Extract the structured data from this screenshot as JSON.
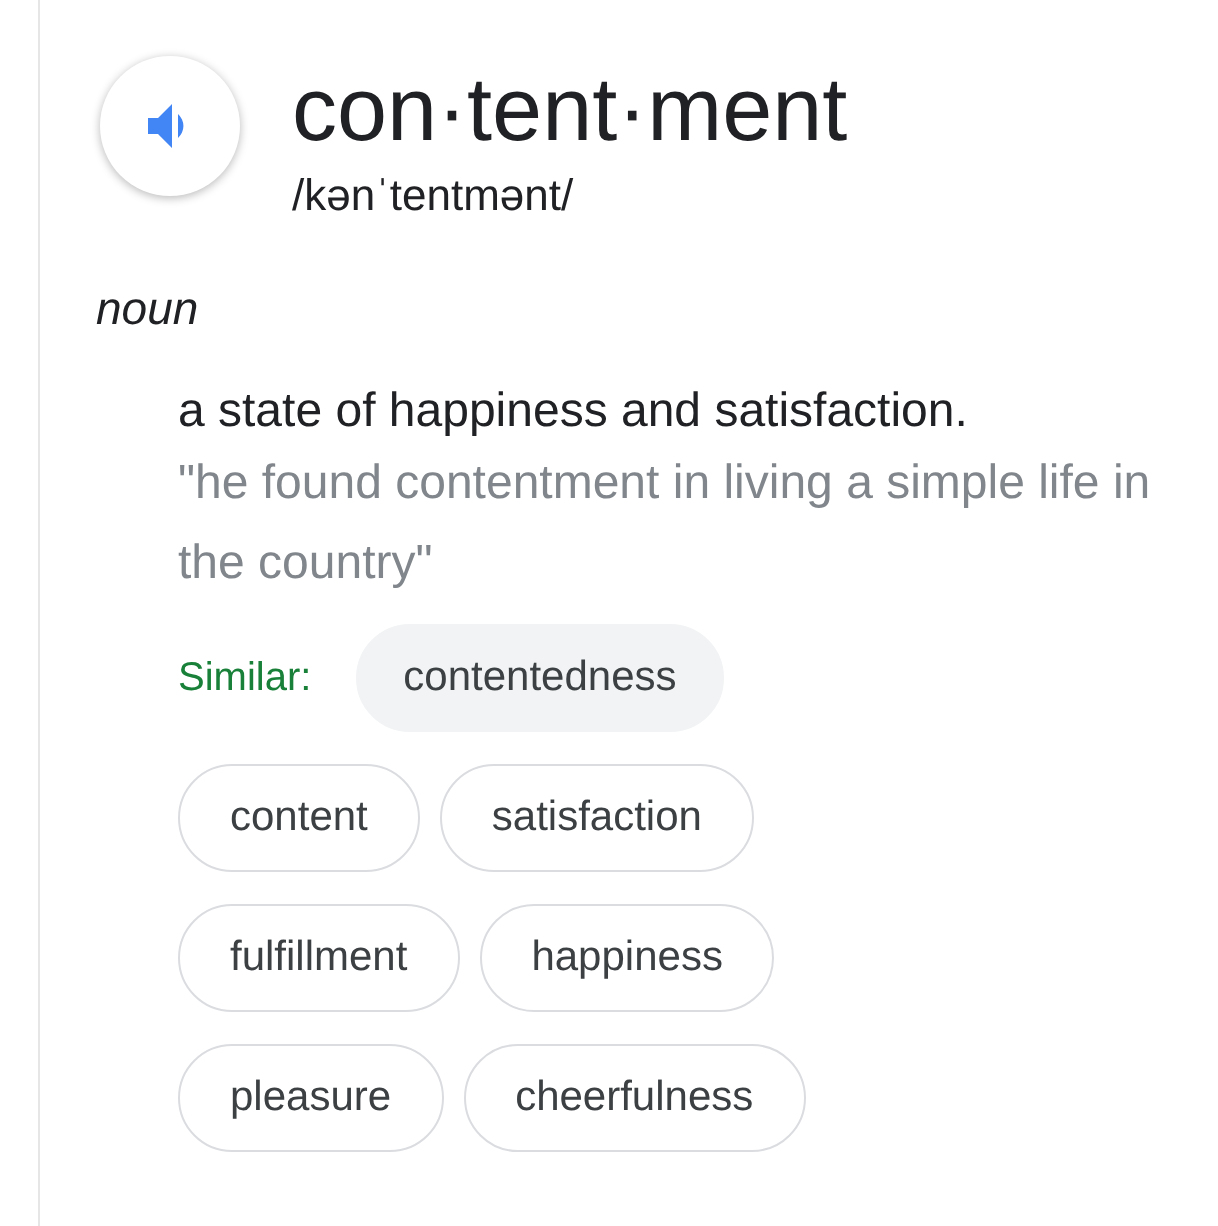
{
  "word": "con·tent·ment",
  "pronunciation": "/kənˈtentmənt/",
  "part_of_speech": "noun",
  "definition": "a state of happiness and satisfaction.",
  "example": "\"he found contentment in living a simple life in the country\"",
  "similar_label": "Similar:",
  "similar": [
    {
      "text": "contentedness",
      "kind": "filled"
    },
    {
      "text": "content",
      "kind": "outlined"
    },
    {
      "text": "satisfaction",
      "kind": "outlined"
    },
    {
      "text": "fulfillment",
      "kind": "outlined"
    },
    {
      "text": "happiness",
      "kind": "outlined"
    },
    {
      "text": "pleasure",
      "kind": "outlined"
    },
    {
      "text": "cheerfulness",
      "kind": "outlined"
    }
  ]
}
